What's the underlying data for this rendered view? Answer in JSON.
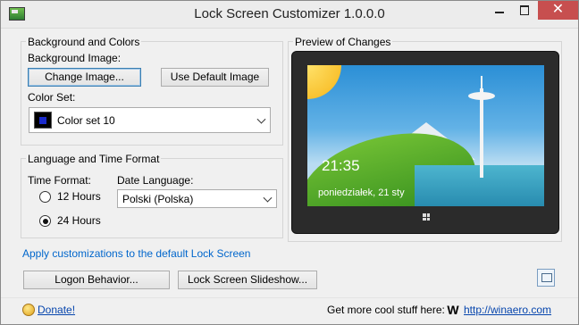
{
  "window": {
    "title": "Lock Screen Customizer 1.0.0.0",
    "close_glyph": "✕"
  },
  "background_group": {
    "title": "Background and Colors",
    "background_image_label": "Background Image:",
    "change_image_button": "Change Image...",
    "default_image_button": "Use Default Image",
    "color_set_label": "Color Set:",
    "color_set_value": "Color set 10",
    "color_swatch": "#1a1a8a"
  },
  "language_group": {
    "title": "Language and Time Format",
    "time_format_label": "Time Format:",
    "time_options": [
      "12 Hours",
      "24 Hours"
    ],
    "selected_time_option": "24 Hours",
    "date_language_label": "Date Language:",
    "date_language_value": "Polski (Polska)"
  },
  "preview": {
    "title": "Preview of Changes",
    "time": "21:35",
    "date": "poniedziałek, 21 sty"
  },
  "apply_link": "Apply customizations to the default Lock Screen",
  "bottom_buttons": {
    "logon_behavior": "Logon Behavior...",
    "slideshow": "Lock Screen Slideshow..."
  },
  "footer": {
    "donate": "Donate!",
    "more_text": "Get more cool stuff here:",
    "logo_letter": "W",
    "url": "http://winaero.com"
  },
  "icons": [
    "app-icon",
    "minimize-icon",
    "maximize-icon",
    "close-icon",
    "chevron-down-icon",
    "settings-helper-icon",
    "donate-icon",
    "winaero-logo"
  ]
}
